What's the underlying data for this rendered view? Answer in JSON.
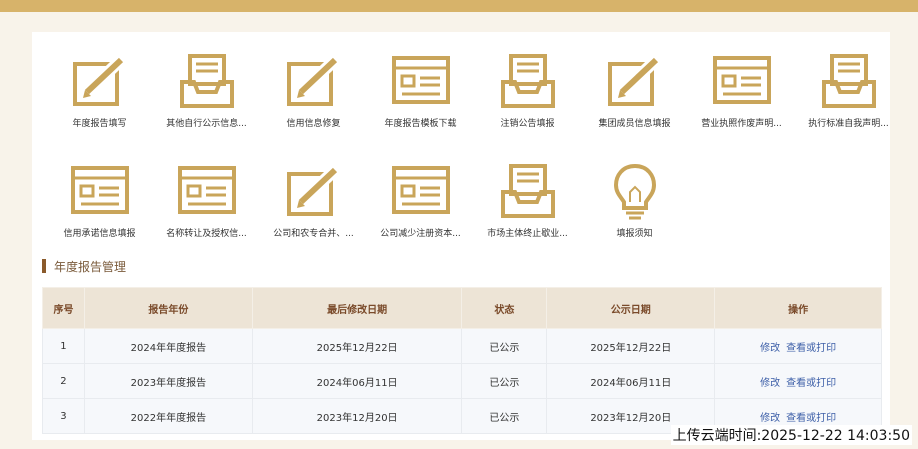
{
  "colors": {
    "accent": "#c9a55a",
    "header": "#d7b36a"
  },
  "icons": [
    {
      "label": "年度报告填写",
      "icon": "pencil-box-icon"
    },
    {
      "label": "其他自行公示信息...",
      "icon": "tray-icon"
    },
    {
      "label": "信用信息修复",
      "icon": "pencil-box-icon"
    },
    {
      "label": "年度报告模板下载",
      "icon": "form-icon"
    },
    {
      "label": "注销公告填报",
      "icon": "tray-icon"
    },
    {
      "label": "集团成员信息填报",
      "icon": "pencil-box-icon"
    },
    {
      "label": "营业执照作废声明...",
      "icon": "form-icon"
    },
    {
      "label": "执行标准自我声明...",
      "icon": "tray-icon"
    },
    {
      "label": "信用承诺信息填报",
      "icon": "form-icon"
    },
    {
      "label": "名称转让及授权信...",
      "icon": "form-icon"
    },
    {
      "label": "公司和农专合并、...",
      "icon": "pencil-box-icon"
    },
    {
      "label": "公司减少注册资本...",
      "icon": "form-icon"
    },
    {
      "label": "市场主体终止歇业...",
      "icon": "tray-icon"
    },
    {
      "label": "填报须知",
      "icon": "lightbulb-icon"
    }
  ],
  "section": {
    "title": "年度报告管理"
  },
  "table": {
    "headers": [
      "序号",
      "报告年份",
      "最后修改日期",
      "状态",
      "公示日期",
      "操作"
    ],
    "rows": [
      {
        "no": "1",
        "year": "2024年年度报告",
        "modified": "2025年12月22日",
        "status": "已公示",
        "published": "2025年12月22日",
        "edit": "修改",
        "view": "查看或打印"
      },
      {
        "no": "2",
        "year": "2023年年度报告",
        "modified": "2024年06月11日",
        "status": "已公示",
        "published": "2024年06月11日",
        "edit": "修改",
        "view": "查看或打印"
      },
      {
        "no": "3",
        "year": "2022年年度报告",
        "modified": "2023年12月20日",
        "status": "已公示",
        "published": "2023年12月20日",
        "edit": "修改",
        "view": "查看或打印"
      }
    ]
  },
  "footer": {
    "upload_time": "上传云端时间:2025-12-22 14:03:50"
  }
}
